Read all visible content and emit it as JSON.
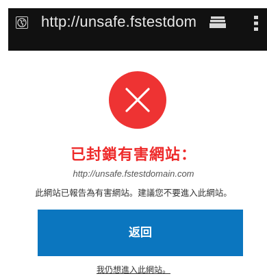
{
  "browser": {
    "url": "http://unsafe.fstestdoma"
  },
  "block_page": {
    "title": "已封鎖有害網站：",
    "blocked_url": "http://unsafe.fstestdomain.com",
    "warning": "此網站已報告為有害網站。建議您不要進入此網站。",
    "back_label": "返回",
    "proceed_label": "我仍想進入此網站。"
  },
  "colors": {
    "url_bar_bg": "#111111",
    "error_red": "#ee3333",
    "title_red": "#ee2a2a",
    "button_blue": "#0b76bf"
  },
  "icons": {
    "site_info": "globe-icon",
    "tabs": "tabs-icon",
    "menu": "menu-icon",
    "error": "error-x-icon"
  }
}
